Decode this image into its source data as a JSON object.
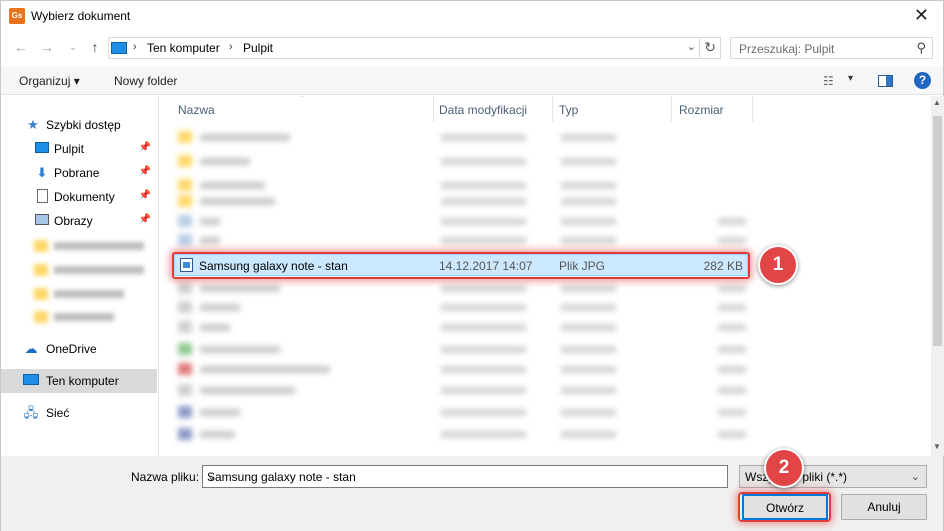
{
  "window": {
    "app_icon": "Gs",
    "title": "Wybierz dokument",
    "close_icon": "✕"
  },
  "address_bar": {
    "breadcrumbs": [
      "Ten komputer",
      "Pulpit"
    ],
    "search_placeholder": "Przeszukaj: Pulpit"
  },
  "toolbar": {
    "organize_label": "Organizuj ▾",
    "new_folder_label": "Nowy folder",
    "help_label": "?"
  },
  "nav": {
    "quick_access": "Szybki dostęp",
    "items": [
      {
        "label": "Pulpit",
        "icon": "desktop-icon"
      },
      {
        "label": "Pobrane",
        "icon": "download-icon"
      },
      {
        "label": "Dokumenty",
        "icon": "documents-icon"
      },
      {
        "label": "Obrazy",
        "icon": "pictures-icon"
      }
    ],
    "onedrive": "OneDrive",
    "this_pc": "Ten komputer",
    "network": "Sieć"
  },
  "file_list": {
    "columns": [
      "Nazwa",
      "Data modyfikacji",
      "Typ",
      "Rozmiar"
    ],
    "selected_file": {
      "name": "Samsung galaxy note - stan",
      "modified": "14.12.2017 14:07",
      "type": "Plik JPG",
      "size": "282 KB"
    }
  },
  "bottom": {
    "filename_label": "Nazwa pliku:",
    "filename_value": "Samsung galaxy note - stan",
    "filter_value": "Wszystkie pliki (*.*)",
    "open_label": "Otwórz",
    "cancel_label": "Anuluj"
  },
  "annotations": {
    "badge1": "1",
    "badge2": "2"
  },
  "colors": {
    "accent": "#0078d7",
    "selection": "#cce8ff",
    "annotation": "#e24545"
  }
}
